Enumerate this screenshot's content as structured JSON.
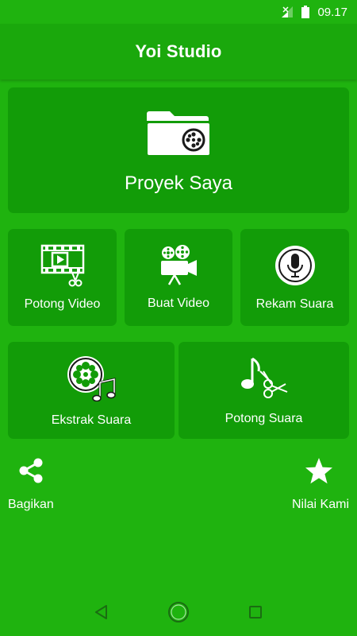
{
  "status_bar": {
    "time": "09.17",
    "icons": [
      "signal-icon",
      "battery-icon"
    ]
  },
  "app_bar": {
    "title": "Yoi Studio"
  },
  "project_card": {
    "label": "Proyek Saya",
    "icon": "folder-reel-icon"
  },
  "tools": [
    {
      "label": "Potong Video",
      "icon": "film-scissors-icon"
    },
    {
      "label": "Buat Video",
      "icon": "video-camera-icon"
    },
    {
      "label": "Rekam Suara",
      "icon": "microphone-icon"
    },
    {
      "label": "Ekstrak Suara",
      "icon": "reel-music-note-icon"
    },
    {
      "label": "Potong Suara",
      "icon": "music-note-scissors-icon"
    }
  ],
  "bottom_actions": {
    "share_label": "Bagikan",
    "rate_label": "Nilai Kami"
  },
  "nav_bar": {
    "icons": [
      "back-icon",
      "home-icon",
      "recents-icon"
    ]
  },
  "colors": {
    "background": "#1fb30f",
    "card": "#129c08",
    "app_bar": "#1aa80c",
    "foreground": "#ffffff"
  }
}
